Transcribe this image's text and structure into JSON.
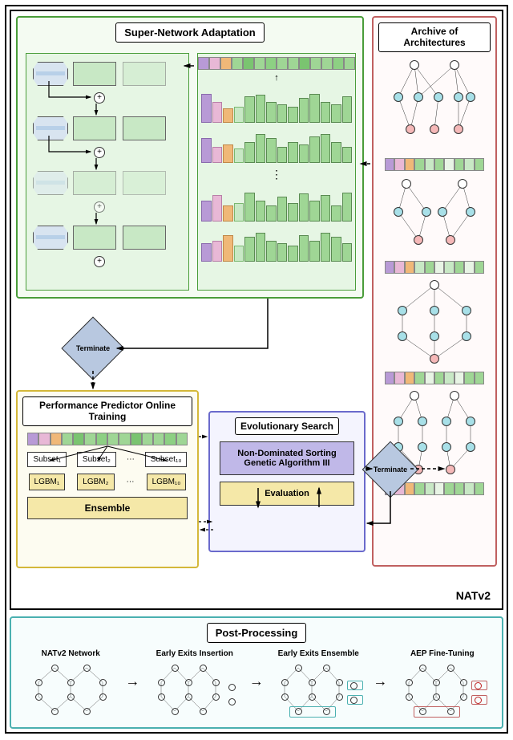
{
  "sections": {
    "supernet_title": "Super-Network Adaptation",
    "archive_title": "Archive of Architectures",
    "predictor_title": "Performance Predictor Online Training",
    "evo_title": "Evolutionary Search",
    "post_title": "Post-Processing"
  },
  "evo": {
    "nsga_label": "Non-Dominated Sorting Genetic Algorithm III",
    "eval_label": "Evaluation"
  },
  "predictor": {
    "subsets": [
      "Subset₁",
      "Subset₂",
      "Subset₁₀"
    ],
    "lgbms": [
      "LGBM₁",
      "LGBM₂",
      "LGBM₁₀"
    ],
    "ensemble_label": "Ensemble",
    "dots": "⋯"
  },
  "diamonds": {
    "terminate": "Terminate"
  },
  "main_label": "NATv2",
  "post_steps": [
    "NATv2 Network",
    "Early Exits Insertion",
    "Early Exits Ensemble",
    "AEP Fine-Tuning"
  ]
}
